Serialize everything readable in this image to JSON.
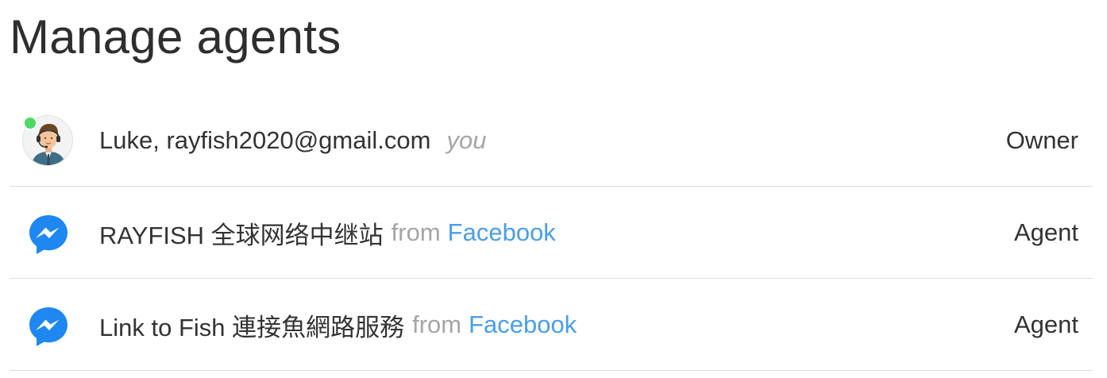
{
  "page": {
    "title": "Manage agents"
  },
  "agents": [
    {
      "name": "Luke, rayfish2020@gmail.com",
      "tag": "you",
      "role": "Owner",
      "avatar": "agent-avatar-icon",
      "status": "online",
      "status_color": "#4cd964"
    },
    {
      "name": "RAYFISH 全球网络中继站",
      "from_label": "from",
      "source": "Facebook",
      "role": "Agent",
      "avatar": "messenger-icon"
    },
    {
      "name": "Link to Fish 連接魚網路服務",
      "from_label": "from",
      "source": "Facebook",
      "role": "Agent",
      "avatar": "messenger-icon"
    }
  ],
  "colors": {
    "link": "#4a9ee6",
    "muted": "#a5a5a5",
    "messenger": "#1e88f0",
    "divider": "#dedede"
  }
}
